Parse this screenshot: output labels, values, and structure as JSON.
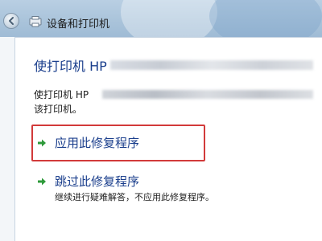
{
  "window": {
    "title": "设备和打印机"
  },
  "dialog": {
    "heading": "使打印机 HP",
    "description_line1": "使打印机 HP",
    "description_line2": "该打印机。"
  },
  "options": [
    {
      "label": "应用此修复程序",
      "icon": "green-arrow-icon"
    },
    {
      "label": "跳过此修复程序",
      "subtext": "继续进行疑难解答，不应用此修复程序。",
      "icon": "green-arrow-icon"
    }
  ],
  "colors": {
    "link_blue": "#1a3e8c",
    "arrow_green": "#2e9a3a",
    "highlight_red": "#d23a3a"
  }
}
